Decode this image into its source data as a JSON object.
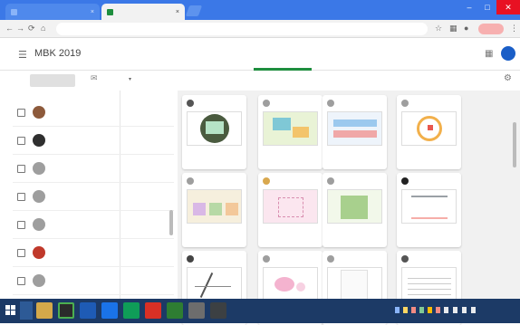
{
  "browser": {
    "tabs": [
      {
        "label": "",
        "active": false
      },
      {
        "label": "",
        "active": true
      }
    ],
    "url": "",
    "window_controls": [
      "–",
      "□",
      "✕"
    ]
  },
  "classroom": {
    "title": "MBK 2019",
    "tabs": [
      {
        "label": "",
        "active": false
      },
      {
        "label": "",
        "active": true
      }
    ]
  },
  "toolbar": {
    "return_label": "",
    "sort_label": ""
  },
  "students": [
    {
      "name": "",
      "grade": "",
      "avatar_color": "#8d5a3b"
    },
    {
      "name": "",
      "grade": "",
      "avatar_color": "#2f2f2f"
    },
    {
      "name": "",
      "grade": "",
      "avatar_color": "#9e9e9e"
    },
    {
      "name": "",
      "grade": "",
      "avatar_color": "#9e9e9e"
    },
    {
      "name": "",
      "grade": "",
      "avatar_color": "#9e9e9e"
    },
    {
      "name": "",
      "grade": "",
      "avatar_color": "#c0392b"
    },
    {
      "name": "",
      "grade": "",
      "avatar_color": "#9e9e9e"
    },
    {
      "name": "",
      "grade": "",
      "avatar_color": "#9e9e9e"
    }
  ],
  "cards": [
    {
      "name": "",
      "file": "",
      "status": "",
      "thumb": "circle-green",
      "avatar_color": "#555"
    },
    {
      "name": "",
      "file": "",
      "status": "",
      "thumb": "map-color",
      "avatar_color": "#9e9e9e"
    },
    {
      "name": "",
      "file": "",
      "status": "",
      "thumb": "chart-color",
      "avatar_color": "#9e9e9e"
    },
    {
      "name": "",
      "file": "",
      "status": "",
      "thumb": "circle-orange",
      "avatar_color": "#9e9e9e"
    },
    {
      "name": "",
      "file": "",
      "status": "",
      "thumb": "pastel-blocks",
      "avatar_color": "#9e9e9e"
    },
    {
      "name": "",
      "file": "",
      "status": "",
      "thumb": "pink-grid",
      "avatar_color": "#d9a84e"
    },
    {
      "name": "",
      "file": "",
      "status": "",
      "thumb": "green-doc",
      "avatar_color": "#9e9e9e"
    },
    {
      "name": "",
      "file": "",
      "status": "",
      "thumb": "scribble",
      "avatar_color": "#222"
    },
    {
      "name": "",
      "file": "",
      "status": "",
      "thumb": "sketch",
      "avatar_color": "#444"
    },
    {
      "name": "",
      "file": "",
      "status": "",
      "thumb": "pink-blob",
      "avatar_color": "#9e9e9e"
    },
    {
      "name": "",
      "file": "",
      "status": "",
      "thumb": "blank-doc",
      "avatar_color": "#9e9e9e"
    },
    {
      "name": "",
      "file": "",
      "status": "",
      "thumb": "table-doc",
      "avatar_color": "#555"
    }
  ],
  "taskbar": {
    "time": ""
  },
  "colors": {
    "accent": "#1e8e3e",
    "chrome": "#3b78e7",
    "taskbar": "#1c3a66"
  }
}
